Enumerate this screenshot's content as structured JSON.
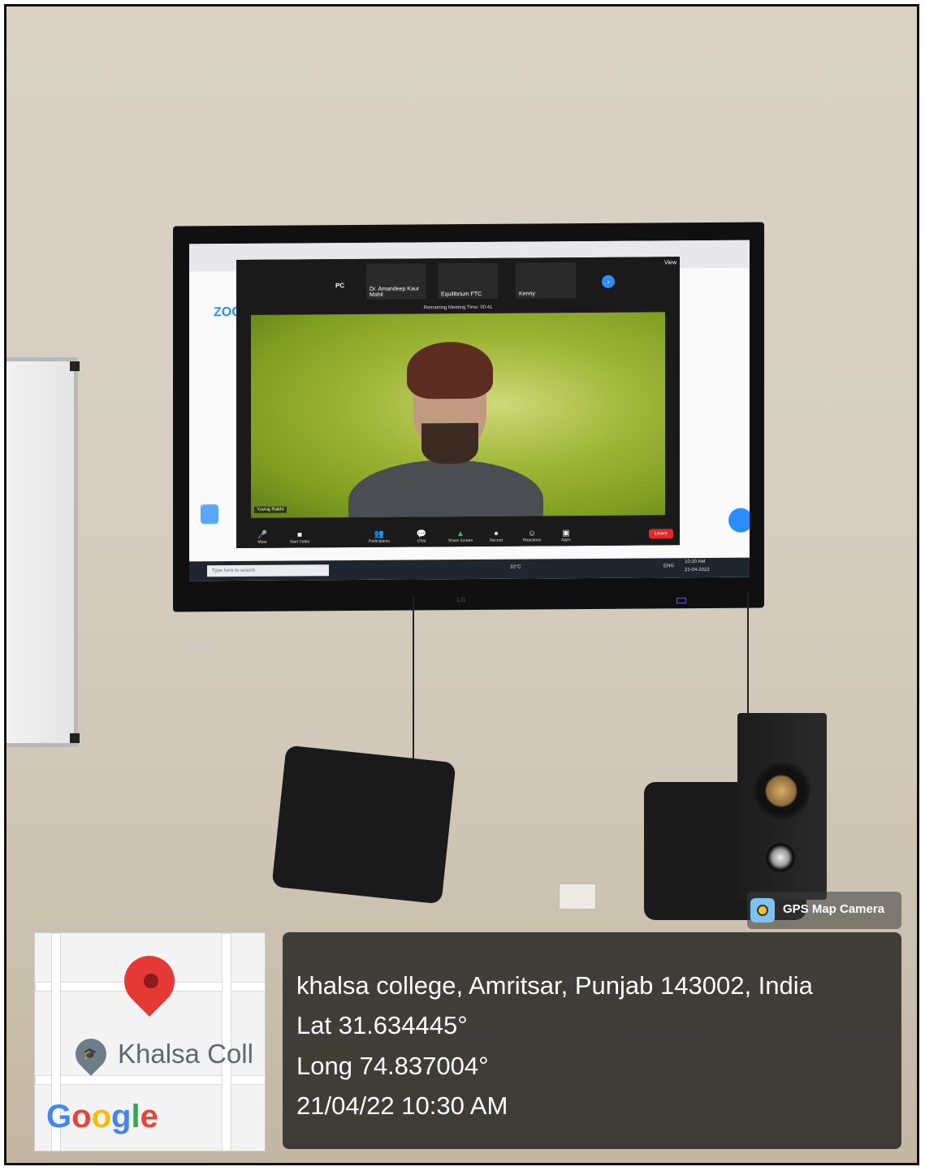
{
  "location": {
    "address": "khalsa college, Amritsar, Punjab 143002, India",
    "latitude": "Lat 31.634445°",
    "longitude": "Long 74.837004°",
    "datetime": "21/04/22 10:30 AM"
  },
  "badge": {
    "label": "GPS Map Camera",
    "icon": "camera-app-icon"
  },
  "map": {
    "place_label": "Khalsa Coll",
    "provider_logo": "Google"
  },
  "screen": {
    "app_logo": "ZOO",
    "self_tile": "PC",
    "participants": [
      {
        "name": "Dr. Amandeep Kaur Mahil"
      },
      {
        "name": "Equilibrium FTC"
      },
      {
        "name": "Kenny"
      }
    ],
    "view_label": "View",
    "remaining_time": "Remaining Meeting Time: 00:41",
    "speaker_name": "Yuvraj Rakhi",
    "toolbar": [
      "Mute",
      "Start Video",
      "Participants",
      "Chat",
      "Share Screen",
      "Record",
      "Reactions",
      "Apps"
    ],
    "leave_label": "Leave",
    "search_placeholder": "Type here to search",
    "weather": "33°C",
    "lang": "ENG",
    "clock_time": "10:30 AM",
    "clock_date": "21-04-2022",
    "tv_brand": "LG"
  }
}
